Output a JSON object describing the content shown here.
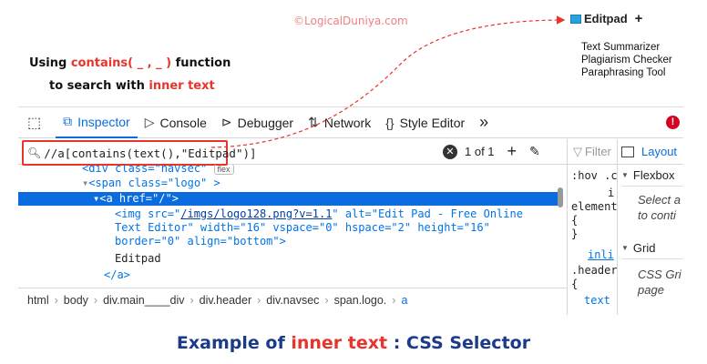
{
  "watermark": "©LogicalDuniya.com",
  "note": {
    "line1_pre": "Using ",
    "line1_hl": "contains( _ , _ )",
    "line1_post": " function",
    "line2_pre": "to search with ",
    "line2_hl": "inner text"
  },
  "site": {
    "brand": "Editpad",
    "plus": "+",
    "menu": [
      "Text Summarizer",
      "Plagiarism Checker",
      "Paraphrasing Tool"
    ]
  },
  "toolbar": {
    "tabs": [
      {
        "label": "Inspector",
        "icon": "inspector-icon"
      },
      {
        "label": "Console",
        "icon": "console-icon"
      },
      {
        "label": "Debugger",
        "icon": "debugger-icon"
      },
      {
        "label": "Network",
        "icon": "network-icon"
      },
      {
        "label": "Style Editor",
        "icon": "style-editor-icon"
      }
    ],
    "more": "»",
    "error_badge": "!"
  },
  "search": {
    "value": "//a[contains(text(),\"Editpad\")]",
    "count": "1 of 1",
    "add": "+"
  },
  "markup": {
    "line0_pre": "<div class=\"navsec\"",
    "line0_badge": "flex",
    "line1": "<span class=\"logo\" >",
    "line2": "<a href=\"/\">",
    "line3_pre": "<img src=\"",
    "line3_link": "/imgs/logo128.png?v=1.1",
    "line3_post": "\" alt=\"Edit Pad - Free Online",
    "line4": "Text Editor\" width=\"16\" vspace=\"0\" hspace=\"2\" height=\"16\"",
    "line5": "border=\"0\" align=\"bottom\">",
    "line6": "Editpad",
    "line7": "</a>"
  },
  "breadcrumb": [
    "html",
    "body",
    "div.main____div",
    "div.header",
    "div.navsec",
    "span.logo.",
    "a"
  ],
  "rules": {
    "filter": "Filter",
    "l1": ":hov .cl",
    "l2": "i",
    "l3": "element",
    "l4": "{",
    "l5": "}",
    "l6": "inli",
    "l7": ".header",
    "l8": "{",
    "l9": "text"
  },
  "layout": {
    "tab": "Layout",
    "flexbox": "Flexbox",
    "flexbox_desc": [
      "Select a",
      "to conti"
    ],
    "grid": "Grid",
    "grid_desc": [
      "CSS Gri",
      "page"
    ]
  },
  "caption": {
    "pre": "Example of ",
    "hl": "inner text",
    "post": " : CSS Selector"
  }
}
